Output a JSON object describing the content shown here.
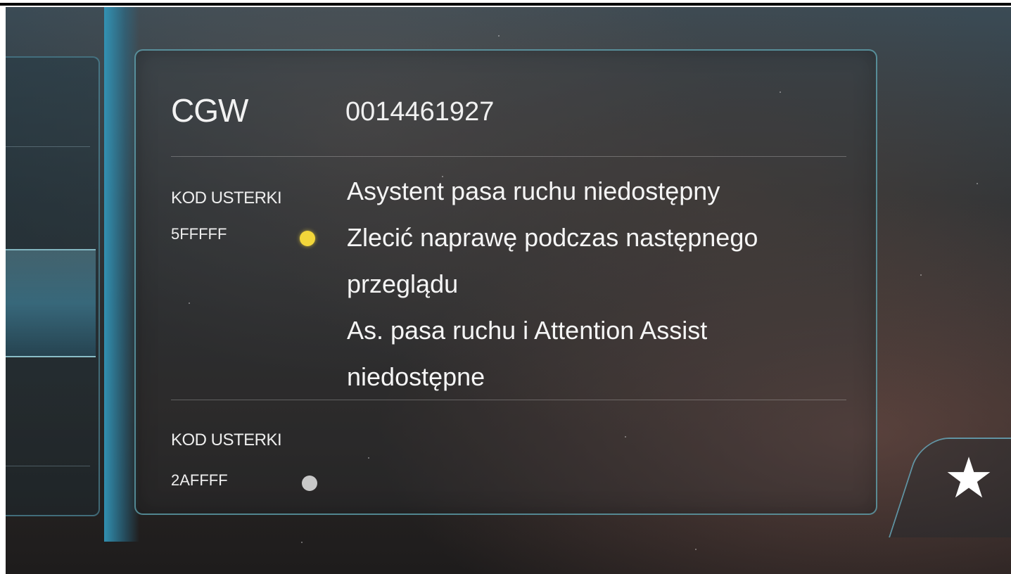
{
  "header": {
    "ecu_name": "CGW",
    "part_number": "0014461927"
  },
  "faults": [
    {
      "label": "KOD USTERKI",
      "code": "5FFFFF",
      "status_color": "#f2d63a",
      "messages": [
        "Asystent pasa ruchu niedostępny",
        "Zlecić naprawę podczas następnego",
        "przeglądu",
        "As. pasa ruchu i Attention Assist",
        "niedostępne"
      ]
    },
    {
      "label": "KOD USTERKI",
      "code": "2AFFFF",
      "status_color": "#c8c8c8"
    }
  ],
  "favorite": {
    "icon": "star-icon",
    "color": "#ffffff"
  },
  "colors": {
    "accent_cyan": "#3296b9",
    "text": "#f2f2f2"
  }
}
